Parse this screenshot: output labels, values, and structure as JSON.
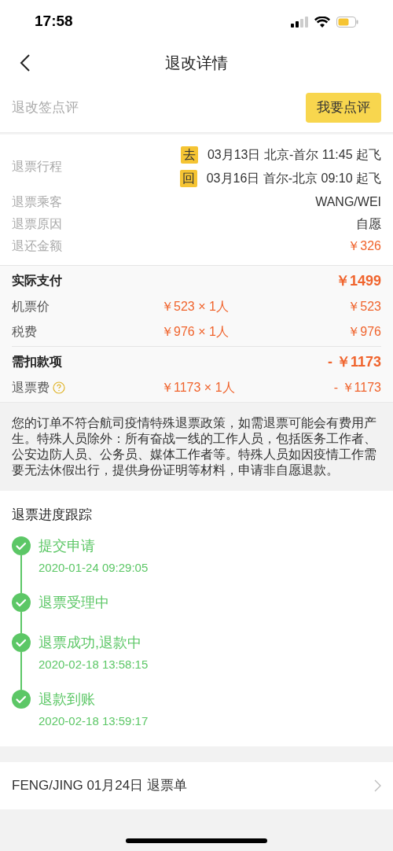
{
  "status_bar": {
    "time": "17:58"
  },
  "nav": {
    "title": "退改详情"
  },
  "review": {
    "label": "退改签点评",
    "button": "我要点评"
  },
  "trip": {
    "label": "退票行程",
    "segments": [
      {
        "tag": "去",
        "text": "03月13日 北京-首尔 11:45 起飞"
      },
      {
        "tag": "回",
        "text": "03月16日 首尔-北京 09:10 起飞"
      }
    ]
  },
  "info_rows": [
    {
      "label": "退票乘客",
      "value": "WANG/WEI",
      "kind": "plain"
    },
    {
      "label": "退票原因",
      "value": "自愿",
      "kind": "plain"
    },
    {
      "label": "退还金额",
      "value": "￥326",
      "kind": "amount"
    }
  ],
  "payment_groups": [
    {
      "title": "实际支付",
      "total": "￥1499",
      "items": [
        {
          "label": "机票价",
          "unit": "￥523 × 1人",
          "amount": "￥523",
          "help": false
        },
        {
          "label": "税费",
          "unit": "￥976 × 1人",
          "amount": "￥976",
          "help": false
        }
      ]
    },
    {
      "title": "需扣款项",
      "total": "- ￥1173",
      "items": [
        {
          "label": "退票费",
          "unit": "￥1173 × 1人",
          "amount": "- ￥1173",
          "help": true
        }
      ]
    }
  ],
  "notice": "您的订单不符合航司疫情特殊退票政策，如需退票可能会有费用产生。特殊人员除外：所有奋战一线的工作人员，包括医务工作者、公安边防人员、公务员、媒体工作者等。特殊人员如因疫情工作需要无法休假出行，提供身份证明等材料，申请非自愿退款。",
  "progress": {
    "title": "退票进度跟踪",
    "steps": [
      {
        "title": "提交申请",
        "time": "2020-01-24 09:29:05",
        "done": true
      },
      {
        "title": "退票受理中",
        "done": true
      },
      {
        "title": "退票成功,退款中",
        "time": "2020-02-18 13:58:15",
        "done": true
      },
      {
        "title": "退款到账",
        "time": "2020-02-18 13:59:17",
        "done": true
      }
    ]
  },
  "refund_link": {
    "text": "FENG/JING 01月24日 退票单"
  }
}
